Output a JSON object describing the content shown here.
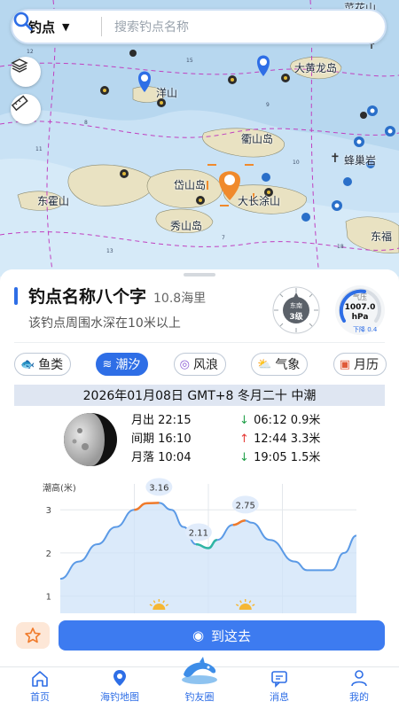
{
  "search": {
    "type_label": "钓点",
    "placeholder": "搜索钓点名称"
  },
  "map": {
    "labels": [
      "大黄龙岛",
      "洋山",
      "衢山岛",
      "蜂巢岩",
      "东霍山",
      "岱山岛",
      "大长涂山",
      "秀山岛",
      "东福",
      "菜花山"
    ]
  },
  "spot": {
    "name": "钓点名称八个字",
    "distance": "10.8海里",
    "description": "该钓点周围水深在10米以上",
    "compass_text": "东南",
    "compass_value": "3级",
    "pressure_label": "气压",
    "pressure_value": "1007.0",
    "pressure_unit": "hPa",
    "pressure_trend": "下降 0.4"
  },
  "tabs": [
    {
      "label": "鱼类",
      "icon": "fish-icon",
      "active": false
    },
    {
      "label": "潮汐",
      "icon": "waves-icon",
      "active": true
    },
    {
      "label": "风浪",
      "icon": "wind-icon",
      "active": false
    },
    {
      "label": "气象",
      "icon": "weather-icon",
      "active": false
    },
    {
      "label": "月历",
      "icon": "calendar-icon",
      "active": false
    }
  ],
  "tide": {
    "date_line": "2026年01月08日 GMT+8 冬月二十 中潮",
    "moonrise": "月出 22:15",
    "interval": "间期 16:10",
    "moonset": "月落 10:04",
    "events": [
      {
        "dir": "down",
        "arrow": "↓",
        "text": "06:12 0.9米"
      },
      {
        "dir": "up",
        "arrow": "↑",
        "text": "12:44 3.3米"
      },
      {
        "dir": "down",
        "arrow": "↓",
        "text": "19:05 1.5米"
      }
    ]
  },
  "chart_data": {
    "type": "area",
    "ylabel": "潮高(米)",
    "ylim": [
      0.6,
      3.6
    ],
    "yticks": [
      1,
      2,
      3
    ],
    "grid": true,
    "x": [
      0,
      1.5,
      3,
      4.5,
      6,
      7,
      8,
      9,
      10,
      11,
      12,
      12.7,
      14,
      15,
      15.5,
      17,
      19,
      20,
      22,
      23,
      24
    ],
    "values": [
      1.4,
      1.8,
      2.2,
      2.6,
      3.0,
      3.15,
      3.16,
      3.0,
      2.6,
      2.2,
      2.11,
      2.3,
      2.65,
      2.75,
      2.7,
      2.3,
      1.8,
      1.6,
      1.6,
      2.0,
      2.4
    ],
    "annotations": [
      {
        "x": 8,
        "y": 3.16,
        "label": "3.16"
      },
      {
        "x": 11.2,
        "y": 2.11,
        "label": "2.11"
      },
      {
        "x": 15,
        "y": 2.75,
        "label": "2.75"
      }
    ],
    "sun_markers_x": [
      8,
      15
    ]
  },
  "actions": {
    "go_label": "到这去"
  },
  "nav": [
    {
      "label": "首页",
      "icon": "home-icon"
    },
    {
      "label": "海钓地图",
      "icon": "map-pin-icon"
    },
    {
      "label": "钓友圈",
      "icon": "dolphin-icon"
    },
    {
      "label": "消息",
      "icon": "message-icon"
    },
    {
      "label": "我的",
      "icon": "user-icon"
    }
  ],
  "colors": {
    "accent": "#2e6ee6",
    "sea": "#b7d7ef",
    "land": "#e9e2c2",
    "tide_up": "#e53935",
    "tide_down": "#22a04a"
  }
}
